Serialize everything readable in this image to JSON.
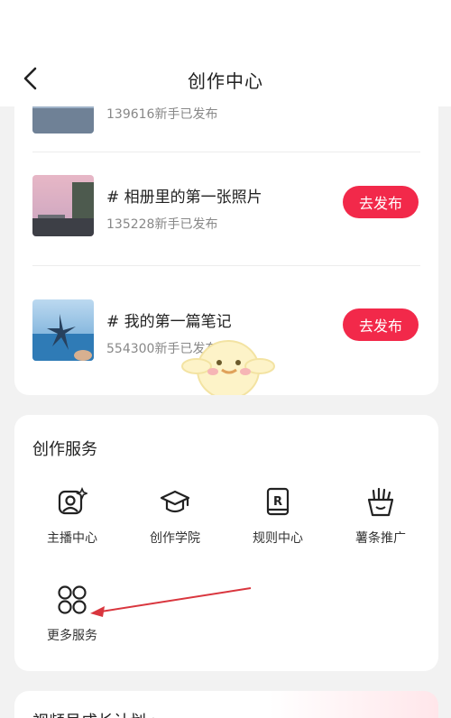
{
  "header": {
    "title": "创作中心"
  },
  "tasks": [
    {
      "title": "",
      "count": "139616新手已发布",
      "button": ""
    },
    {
      "title": "# 相册里的第一张照片",
      "count": "135228新手已发布",
      "button": "去发布"
    },
    {
      "title": "# 我的第一篇笔记",
      "count": "554300新手已发布",
      "button": "去发布"
    }
  ],
  "services": {
    "title": "创作服务",
    "items": [
      {
        "label": "主播中心",
        "icon": "user-sparkle-icon"
      },
      {
        "label": "创作学院",
        "icon": "graduation-cap-icon"
      },
      {
        "label": "规则中心",
        "icon": "rule-book-icon"
      },
      {
        "label": "薯条推广",
        "icon": "fries-icon"
      },
      {
        "label": "更多服务",
        "icon": "grid-circles-icon"
      }
    ]
  },
  "growth": {
    "title": "视频号成长计划 >"
  },
  "colors": {
    "accent": "#f2294a",
    "background": "#f2f2f2",
    "arrow": "#d9363e"
  }
}
